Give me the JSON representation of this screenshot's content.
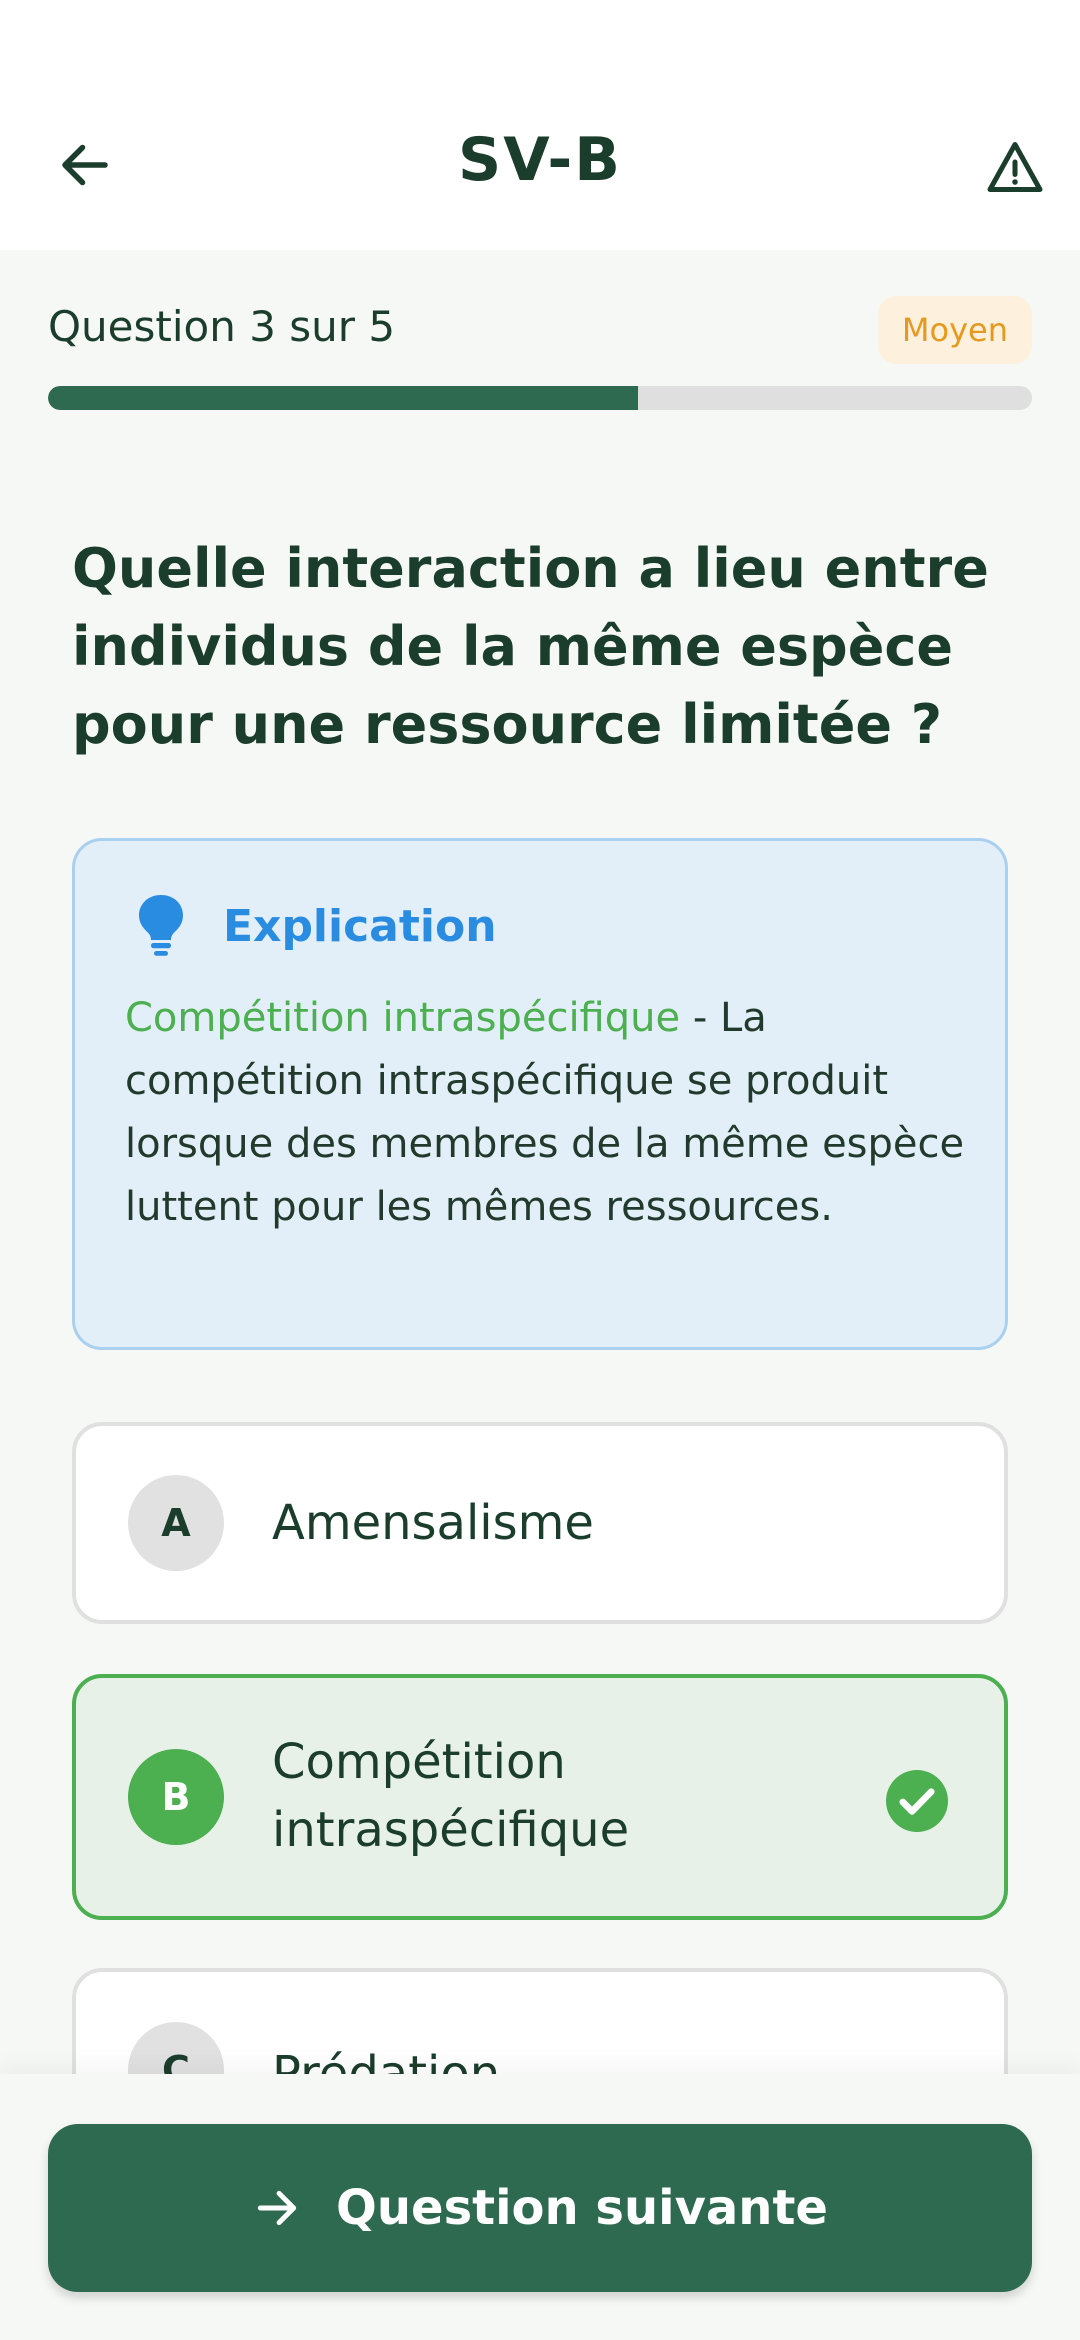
{
  "header": {
    "title": "SV-B",
    "back_icon": "arrow-left-icon",
    "report_icon": "warning-triangle-icon"
  },
  "progress": {
    "label": "Question 3 sur 5",
    "current": 3,
    "total": 5,
    "fraction": 0.6,
    "difficulty": "Moyen"
  },
  "question": {
    "text": "Quelle interaction a lieu entre individus de la même espèce pour une ressource limitée ?"
  },
  "explanation": {
    "icon": "lightbulb-icon",
    "title": "Explication",
    "term": "Compétition intraspécifique",
    "body": " - La compétition intraspécifique se produit lorsque des membres de la même espèce luttent pour les mêmes ressources."
  },
  "options": [
    {
      "letter": "A",
      "label": "Amensalisme",
      "state": "default"
    },
    {
      "letter": "B",
      "label": "Compétition intraspécifique",
      "state": "correct"
    },
    {
      "letter": "C",
      "label": "Prédation",
      "state": "default"
    }
  ],
  "footer": {
    "next_label": "Question suivante",
    "next_icon": "arrow-right-icon"
  },
  "colors": {
    "primary": "#2e6a4f",
    "correct": "#4caf50",
    "info": "#2a8ce0",
    "warning": "#e59a1f"
  }
}
